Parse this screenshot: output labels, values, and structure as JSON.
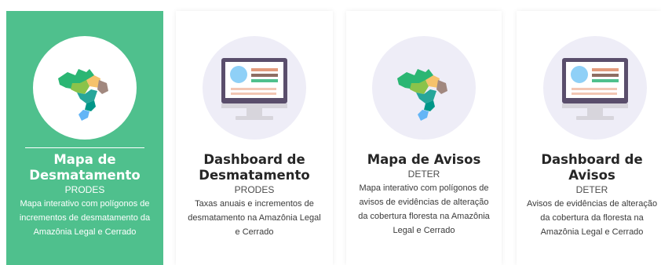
{
  "cards": [
    {
      "title_lines": [
        "Mapa de",
        "Desmatamento"
      ],
      "subtitle": "PRODES",
      "description": "Mapa interativo com polígonos de incrementos de desmatamento da Amazônia Legal e Cerrado",
      "icon": "brazil-map-icon",
      "active": true
    },
    {
      "title_lines": [
        "Dashboard de",
        "Desmatamento"
      ],
      "subtitle": "PRODES",
      "description": "Taxas anuais e incrementos de desmatamento na Amazônia Legal e Cerrado",
      "icon": "dashboard-monitor-icon",
      "active": false
    },
    {
      "title_lines": [
        "Mapa de Avisos"
      ],
      "subtitle": "DETER",
      "description": "Mapa interativo com polígonos de avisos de evidências de alteração da cobertura floresta na Amazônia Legal e Cerrado",
      "icon": "brazil-map-icon",
      "active": false
    },
    {
      "title_lines": [
        "Dashboard de",
        "Avisos"
      ],
      "subtitle": "DETER",
      "description": "Avisos de evidências de alteração da cobertura da floresta na Amazônia Legal e Cerrado",
      "icon": "dashboard-monitor-icon",
      "active": false
    }
  ],
  "colors": {
    "active_bg": "#4fc08d",
    "icon_circle": "#eeedf7",
    "title": "#262626"
  }
}
